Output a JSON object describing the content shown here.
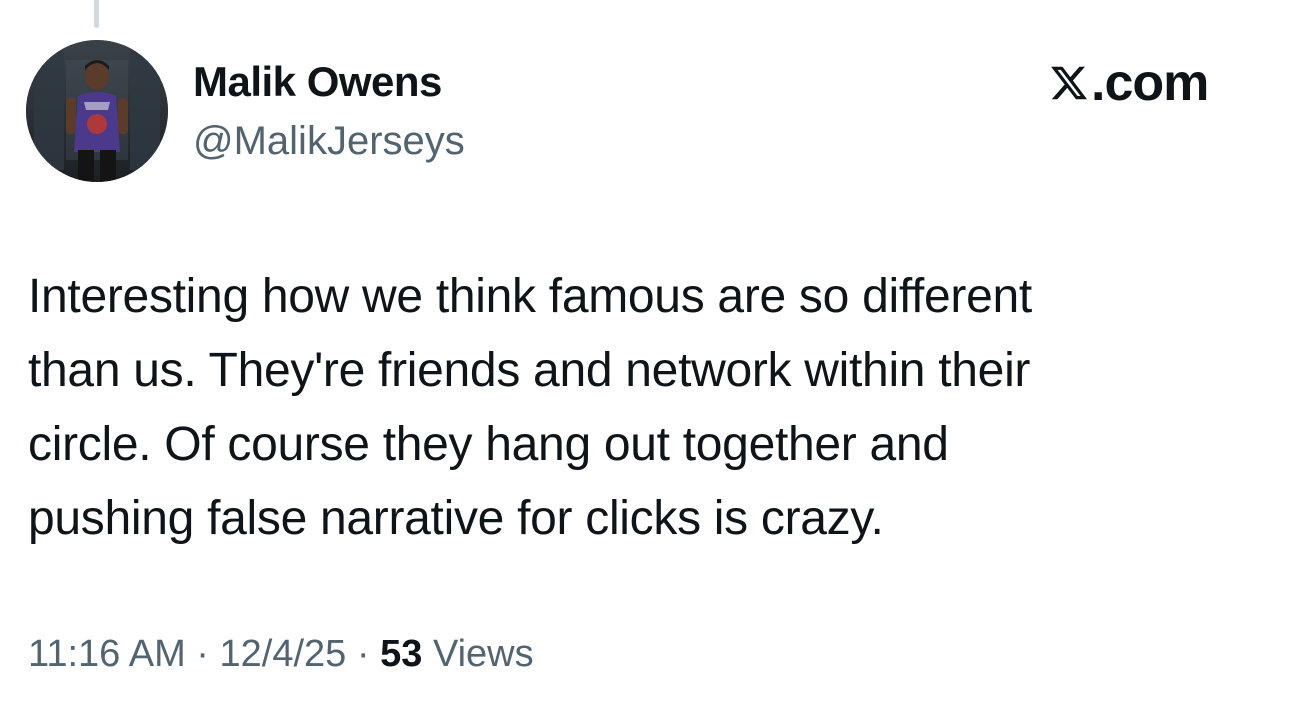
{
  "author": {
    "display_name": "Malik Owens",
    "handle": "@MalikJerseys",
    "avatar_icon": "profile-photo"
  },
  "brand": {
    "logo_icon": "x-logo-icon",
    "domain": ".com"
  },
  "tweet": {
    "lines": [
      "Interesting how we think famous are so different",
      "than us. They're friends and network within their",
      "circle. Of course they hang out together and",
      "pushing false narrative for clicks is crazy."
    ]
  },
  "meta": {
    "time": "11:16 AM",
    "separator": "·",
    "date": "12/4/25",
    "views_count": "53",
    "views_label": "Views"
  },
  "colors": {
    "text": "#0f1419",
    "secondary": "#536471",
    "thread_line": "#cfd9de"
  }
}
